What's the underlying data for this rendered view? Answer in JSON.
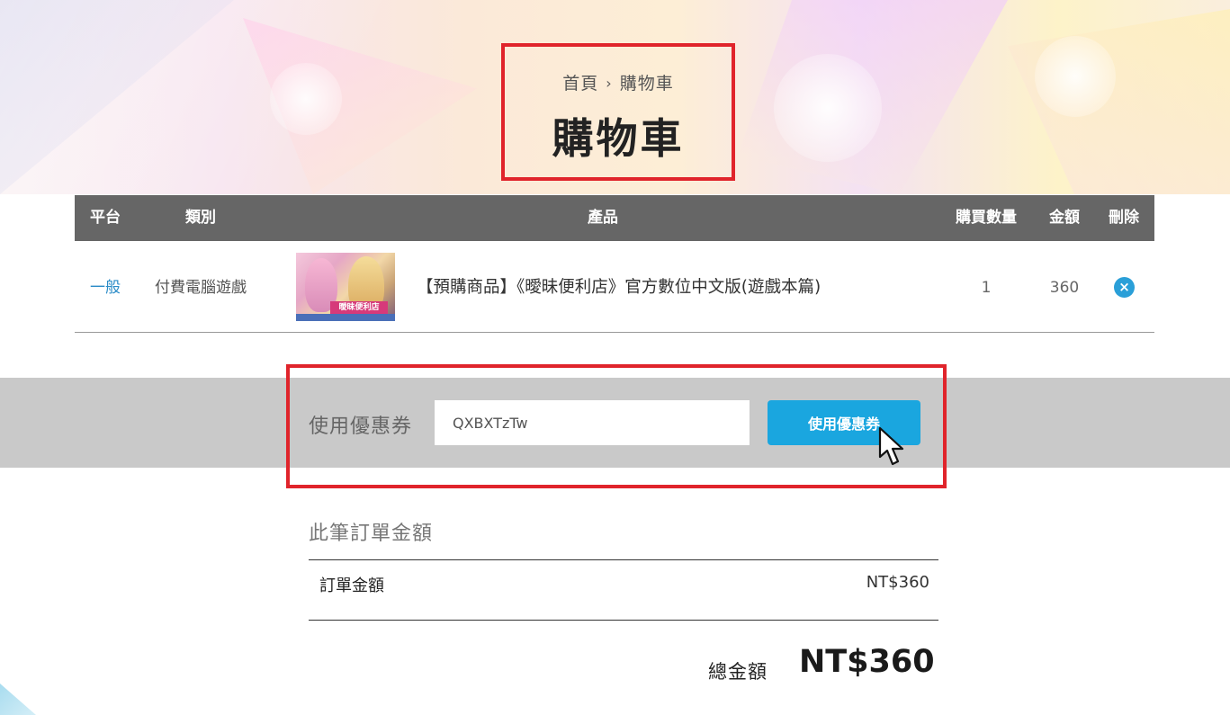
{
  "breadcrumb": {
    "home": "首頁",
    "separator": "›",
    "current": "購物車"
  },
  "page_title": "購物車",
  "cart": {
    "columns": {
      "platform": "平台",
      "category": "類別",
      "product": "產品",
      "quantity": "購買數量",
      "amount": "金額",
      "delete": "刪除"
    },
    "items": [
      {
        "platform": "一般",
        "category": "付費電腦遊戲",
        "thumbnail_text": "曖昧便利店",
        "product": "【預購商品】《曖昧便利店》官方數位中文版(遊戲本篇)",
        "quantity": "1",
        "amount": "360",
        "delete_icon": "×"
      }
    ]
  },
  "coupon": {
    "label": "使用優惠券",
    "input_value": "QXBXTzTw",
    "button_label": "使用優惠券"
  },
  "summary": {
    "heading": "此筆訂單金額",
    "order_amount_label": "訂單金額",
    "order_amount_value": "NT$360",
    "total_label": "總金額",
    "total_value": "NT$360"
  },
  "colors": {
    "highlight": "#e0242b",
    "table_header": "#666666",
    "accent_blue": "#1aa6df",
    "link_blue": "#2a8bc7",
    "coupon_band": "#c9c9c9"
  }
}
